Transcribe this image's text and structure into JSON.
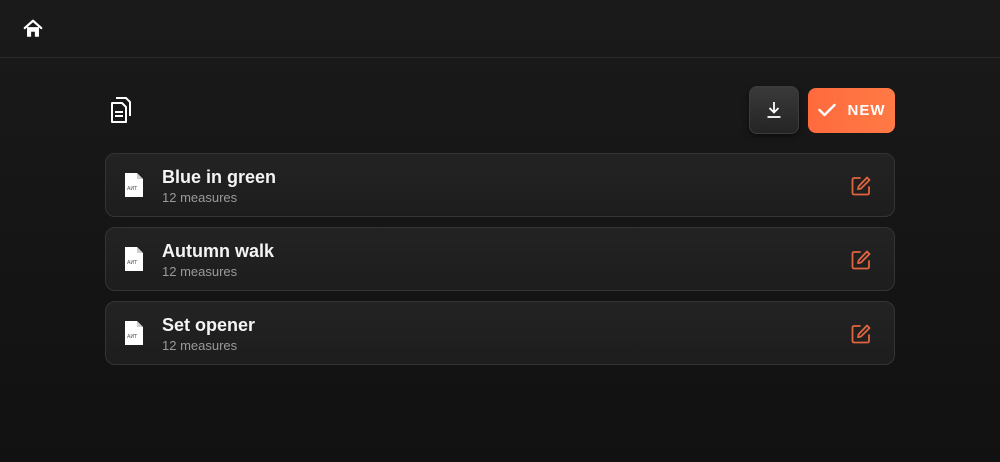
{
  "header": {
    "home_icon": "home-icon"
  },
  "toolbar": {
    "docs_icon": "documents-icon",
    "download_icon": "download-icon",
    "new_label": "NEW",
    "new_icon": "check-icon"
  },
  "colors": {
    "accent": "#ff6a3d",
    "edit_icon": "#e0653f",
    "background": "#141414",
    "card": "#212121"
  },
  "items": [
    {
      "title": "Blue in green",
      "subtitle": "12 measures",
      "file_icon_text": "AИT"
    },
    {
      "title": "Autumn walk",
      "subtitle": "12 measures",
      "file_icon_text": "AИT"
    },
    {
      "title": "Set opener",
      "subtitle": "12 measures",
      "file_icon_text": "AИT"
    }
  ]
}
